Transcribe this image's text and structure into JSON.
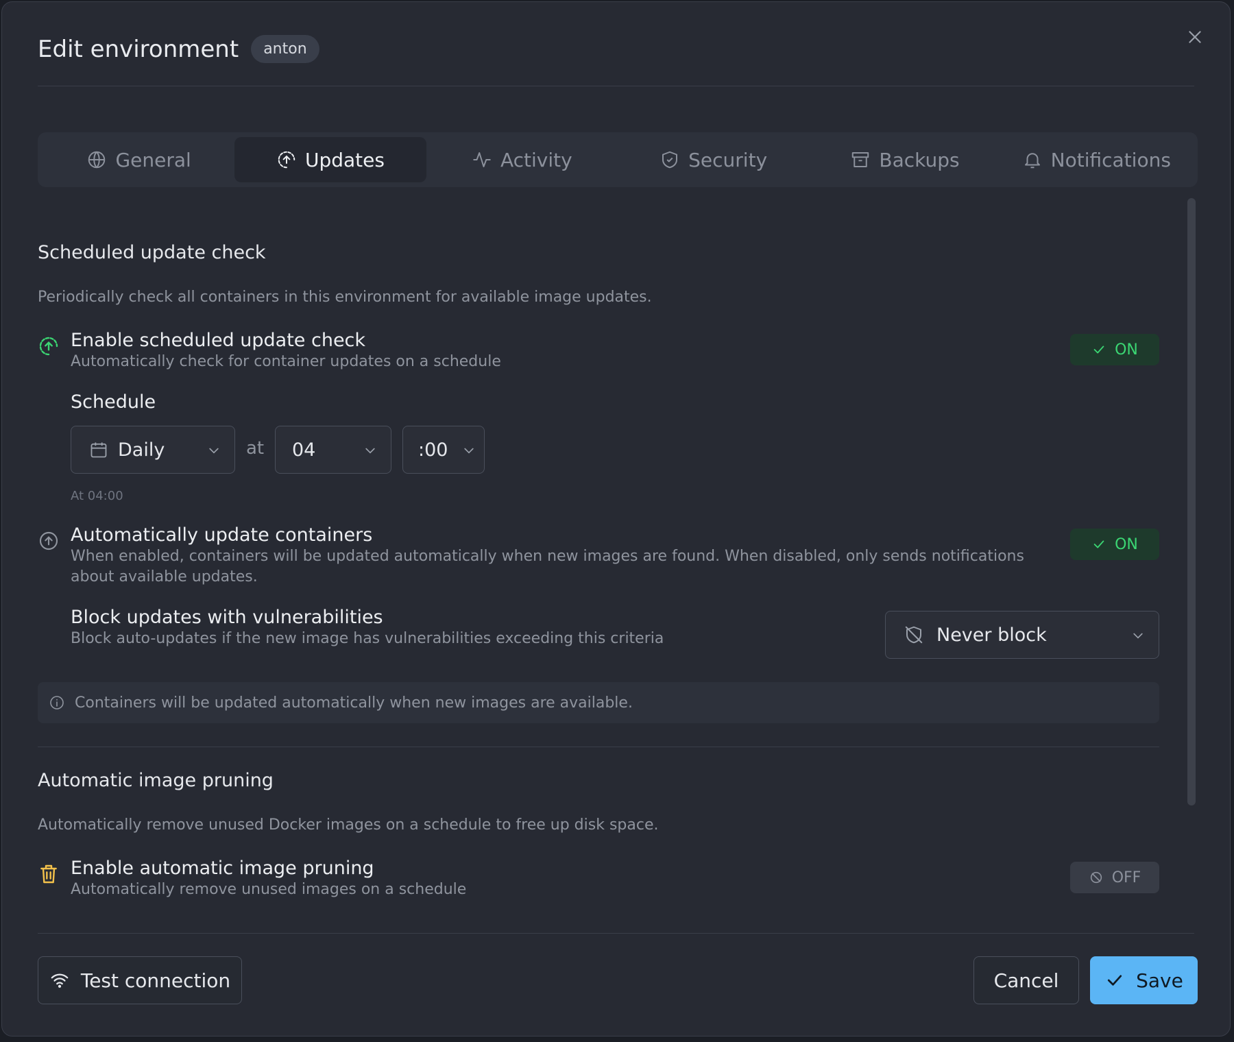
{
  "dialog": {
    "title": "Edit environment",
    "badge": "anton"
  },
  "tabs": [
    {
      "label": "General",
      "icon": "globe-icon"
    },
    {
      "label": "Updates",
      "icon": "update-icon",
      "active": true
    },
    {
      "label": "Activity",
      "icon": "activity-icon"
    },
    {
      "label": "Security",
      "icon": "shield-icon"
    },
    {
      "label": "Backups",
      "icon": "archive-icon"
    },
    {
      "label": "Notifications",
      "icon": "bell-icon"
    }
  ],
  "scheduled": {
    "title": "Scheduled update check",
    "description": "Periodically check all containers in this environment for available image updates.",
    "enable_title": "Enable scheduled update check",
    "enable_sub": "Automatically check for container updates on a schedule",
    "enable_state": "ON",
    "schedule_label": "Schedule",
    "frequency": "Daily",
    "at_label": "at",
    "hour": "04",
    "minute": ":00",
    "summary": "At 04:00"
  },
  "auto_update": {
    "title": "Automatically update containers",
    "sub": "When enabled, containers will be updated automatically when new images are found. When disabled, only sends notifications about available updates.",
    "state": "ON",
    "block_title": "Block updates with vulnerabilities",
    "block_sub": "Block auto-updates if the new image has vulnerabilities exceeding this criteria",
    "block_value": "Never block",
    "info": "Containers will be updated automatically when new images are available."
  },
  "pruning": {
    "title": "Automatic image pruning",
    "description": "Automatically remove unused Docker images on a schedule to free up disk space.",
    "enable_title": "Enable automatic image pruning",
    "enable_sub": "Automatically remove unused images on a schedule",
    "state": "OFF"
  },
  "footer": {
    "test_label": "Test connection",
    "cancel_label": "Cancel",
    "save_label": "Save"
  },
  "colors": {
    "accent": "#5bb5f5",
    "on_green": "#3bd673",
    "warning_yellow": "#f3c14b"
  }
}
